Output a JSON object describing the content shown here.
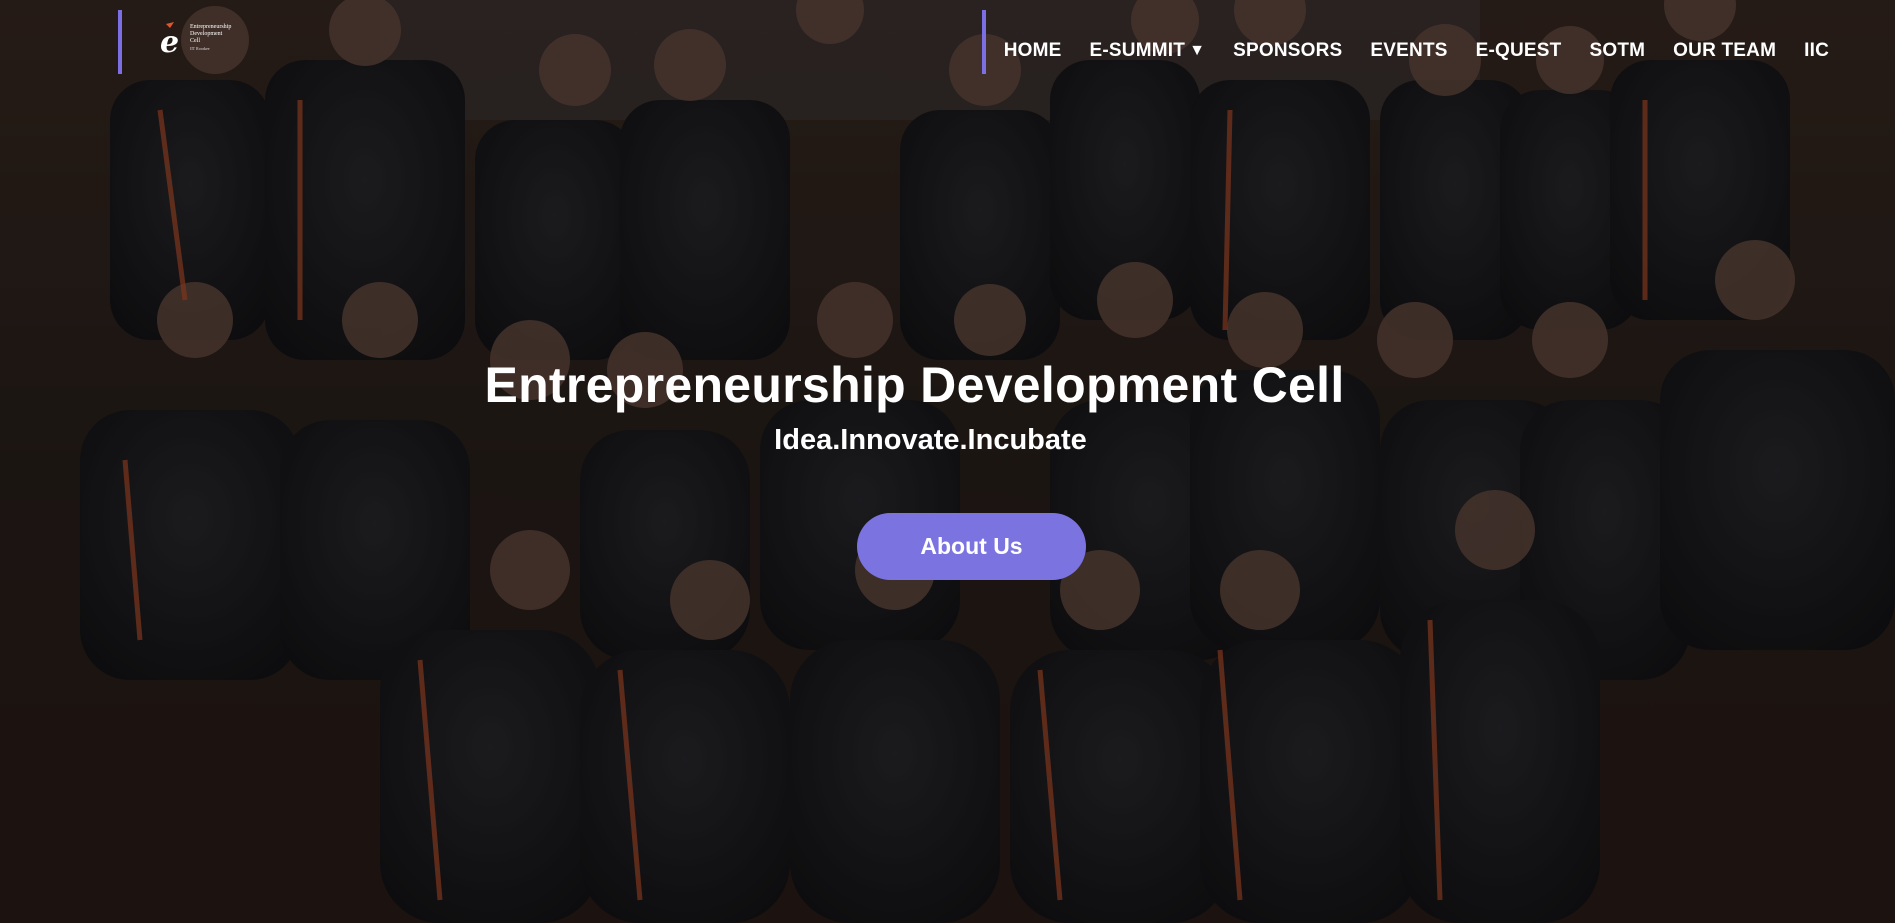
{
  "logo": {
    "line1": "Entrepreneurship",
    "line2": "Development",
    "line3": "Cell",
    "line4": "IIT Roorkee",
    "icon": "edc-logo-icon"
  },
  "nav": {
    "items": [
      {
        "label": "HOME"
      },
      {
        "label": "E-SUMMIT",
        "caret": "▼"
      },
      {
        "label": "SPONSORS"
      },
      {
        "label": "EVENTS"
      },
      {
        "label": "E-QUEST"
      },
      {
        "label": "SOTM"
      },
      {
        "label": "OUR TEAM"
      },
      {
        "label": "IIC"
      }
    ]
  },
  "hero": {
    "title": "Entrepreneurship Development Cell",
    "tagline": "Idea.Innovate.Incubate",
    "button_label": "About Us"
  },
  "colors": {
    "accent": "#7b74e0",
    "bar": "#7b6fe3",
    "text": "#ffffff"
  }
}
